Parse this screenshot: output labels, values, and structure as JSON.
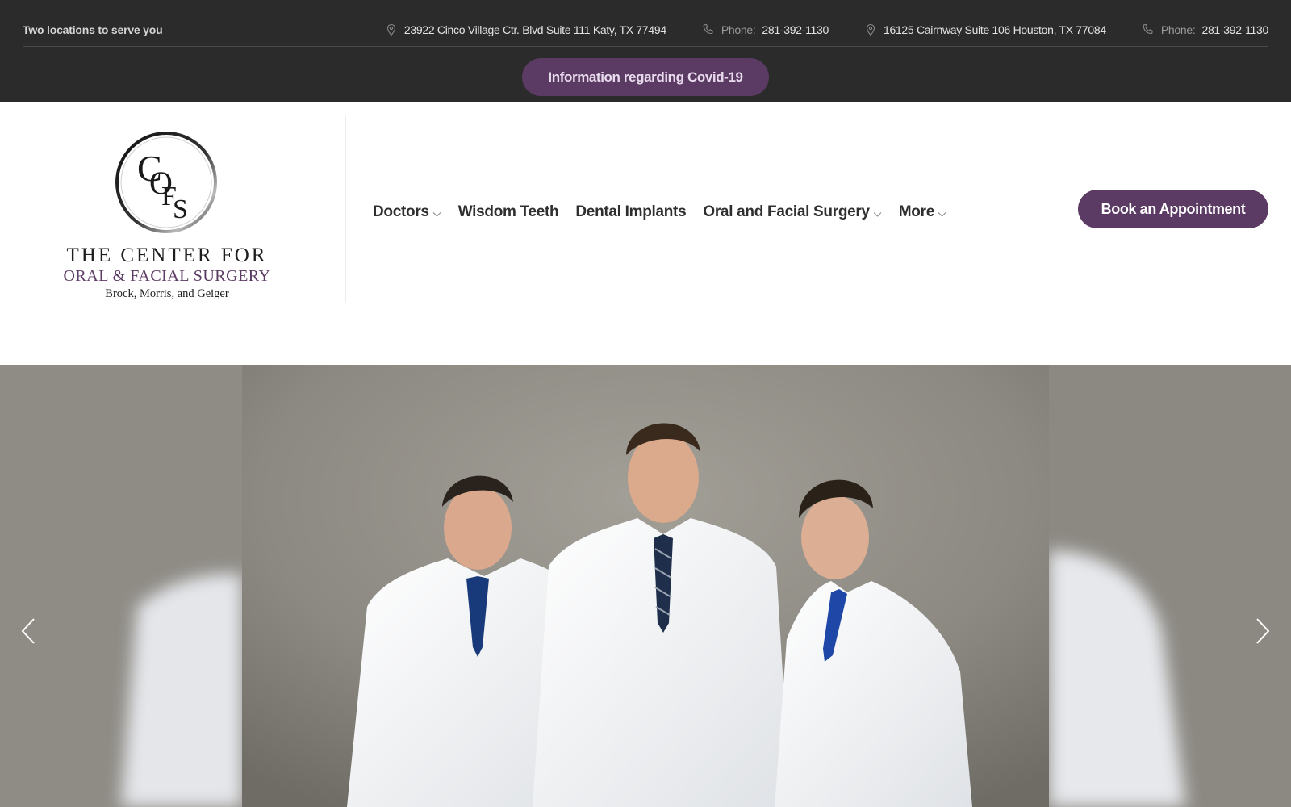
{
  "topbar": {
    "tagline": "Two locations to serve you",
    "locations": [
      {
        "address": "23922 Cinco Village Ctr. Blvd Suite 111 Katy, TX 77494",
        "phone_label": "Phone:",
        "phone": "281-392-1130"
      },
      {
        "address": "16125 Cairnway Suite 106 Houston, TX 77084",
        "phone_label": "Phone:",
        "phone": "281-392-1130"
      }
    ],
    "covid_button": "Information regarding Covid-19"
  },
  "logo": {
    "monogram": "COFS",
    "line1": "The Center For",
    "line2": "Oral & Facial Surgery",
    "line3": "Brock, Morris, and Geiger"
  },
  "nav": {
    "items": [
      {
        "label": "Doctors",
        "dropdown": true
      },
      {
        "label": "Wisdom Teeth",
        "dropdown": false
      },
      {
        "label": "Dental Implants",
        "dropdown": false
      },
      {
        "label": "Oral and Facial Surgery",
        "dropdown": true
      },
      {
        "label": "More",
        "dropdown": true
      }
    ],
    "cta": "Book an Appointment"
  },
  "hero": {
    "image": "three surgeons in white lab coats",
    "prev_icon": "chevron-left-icon",
    "next_icon": "chevron-right-icon"
  },
  "colors": {
    "topbar_bg": "#2b2b2b",
    "accent_purple": "#5b3a63",
    "nav_text": "#2f2f2f"
  }
}
